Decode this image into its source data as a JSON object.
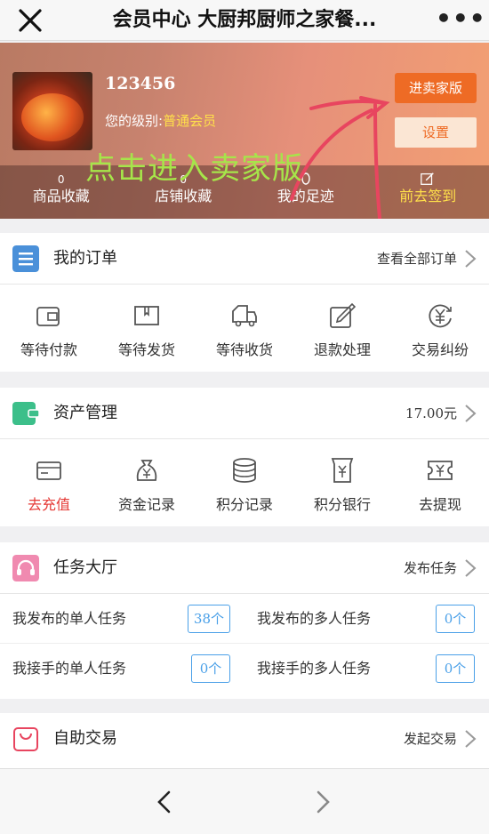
{
  "topbar": {
    "title": "会员中心 大厨邦厨师之家餐...",
    "more": "•••"
  },
  "profile": {
    "username": "123456",
    "level_prefix": "您的级别:",
    "level": "普通会员",
    "seller_button": "进卖家版",
    "settings_button": "设置",
    "overlay_note": "点击进入卖家版",
    "stats": [
      {
        "value": "0",
        "label": "商品收藏"
      },
      {
        "value": "0",
        "label": "店铺收藏"
      },
      {
        "value": "",
        "label": "我的足迹"
      },
      {
        "value": "",
        "label": "前去签到"
      }
    ]
  },
  "orders": {
    "title": "我的订单",
    "link": "查看全部订单",
    "items": [
      {
        "label": "等待付款",
        "icon": "wallet-icon"
      },
      {
        "label": "等待发货",
        "icon": "package-icon"
      },
      {
        "label": "等待收货",
        "icon": "truck-icon"
      },
      {
        "label": "退款处理",
        "icon": "edit-icon"
      },
      {
        "label": "交易纠纷",
        "icon": "yen-refresh-icon"
      }
    ]
  },
  "assets": {
    "title": "资产管理",
    "balance": "17.00元",
    "items": [
      {
        "label": "去充值",
        "icon": "card-icon"
      },
      {
        "label": "资金记录",
        "icon": "money-bag-icon"
      },
      {
        "label": "积分记录",
        "icon": "coins-icon"
      },
      {
        "label": "积分银行",
        "icon": "bank-icon"
      },
      {
        "label": "去提现",
        "icon": "ticket-icon"
      }
    ]
  },
  "tasks": {
    "title": "任务大厅",
    "link": "发布任务",
    "rows": [
      [
        {
          "label": "我发布的单人任务",
          "count": "38个"
        },
        {
          "label": "我发布的多人任务",
          "count": "0个"
        }
      ],
      [
        {
          "label": "我接手的单人任务",
          "count": "0个"
        },
        {
          "label": "我接手的多人任务",
          "count": "0个"
        }
      ]
    ]
  },
  "trade": {
    "title": "自助交易",
    "link": "发起交易"
  },
  "colors": {
    "accent_orange": "#ee6b25",
    "badge_blue": "#4aa0e8",
    "highlight_yellow": "#ffe04a",
    "overlay_green": "#a6e54a",
    "red_label": "#e53935"
  }
}
